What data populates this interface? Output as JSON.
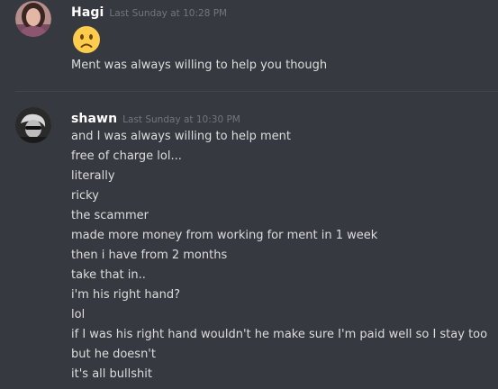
{
  "messages": [
    {
      "username": "Hagi",
      "timestamp": "Last Sunday at 10:28 PM",
      "avatar": "avatar-user-photo",
      "emoji": "slightly-frowning-face",
      "lines": [
        "Ment was always willing to help you though"
      ]
    },
    {
      "username": "shawn",
      "timestamp": "Last Sunday at 10:30 PM",
      "avatar": "avatar-user-photo",
      "lines": [
        "and I was always willing to help ment",
        "free of charge lol...",
        "literally",
        "ricky",
        "the scammer",
        "made more money from working for ment in 1 week",
        "then i have from 2 months",
        "take that in..",
        "i'm his right hand?",
        "lol",
        "if I was his right hand wouldn't he make sure I'm paid well so I stay too",
        "but he doesn't",
        "it's all bullshit"
      ]
    }
  ],
  "colors": {
    "background": "#36393f",
    "username": "#ffffff",
    "timestamp": "#72767d",
    "message_text": "#dcddde",
    "divider": "#42454a"
  }
}
